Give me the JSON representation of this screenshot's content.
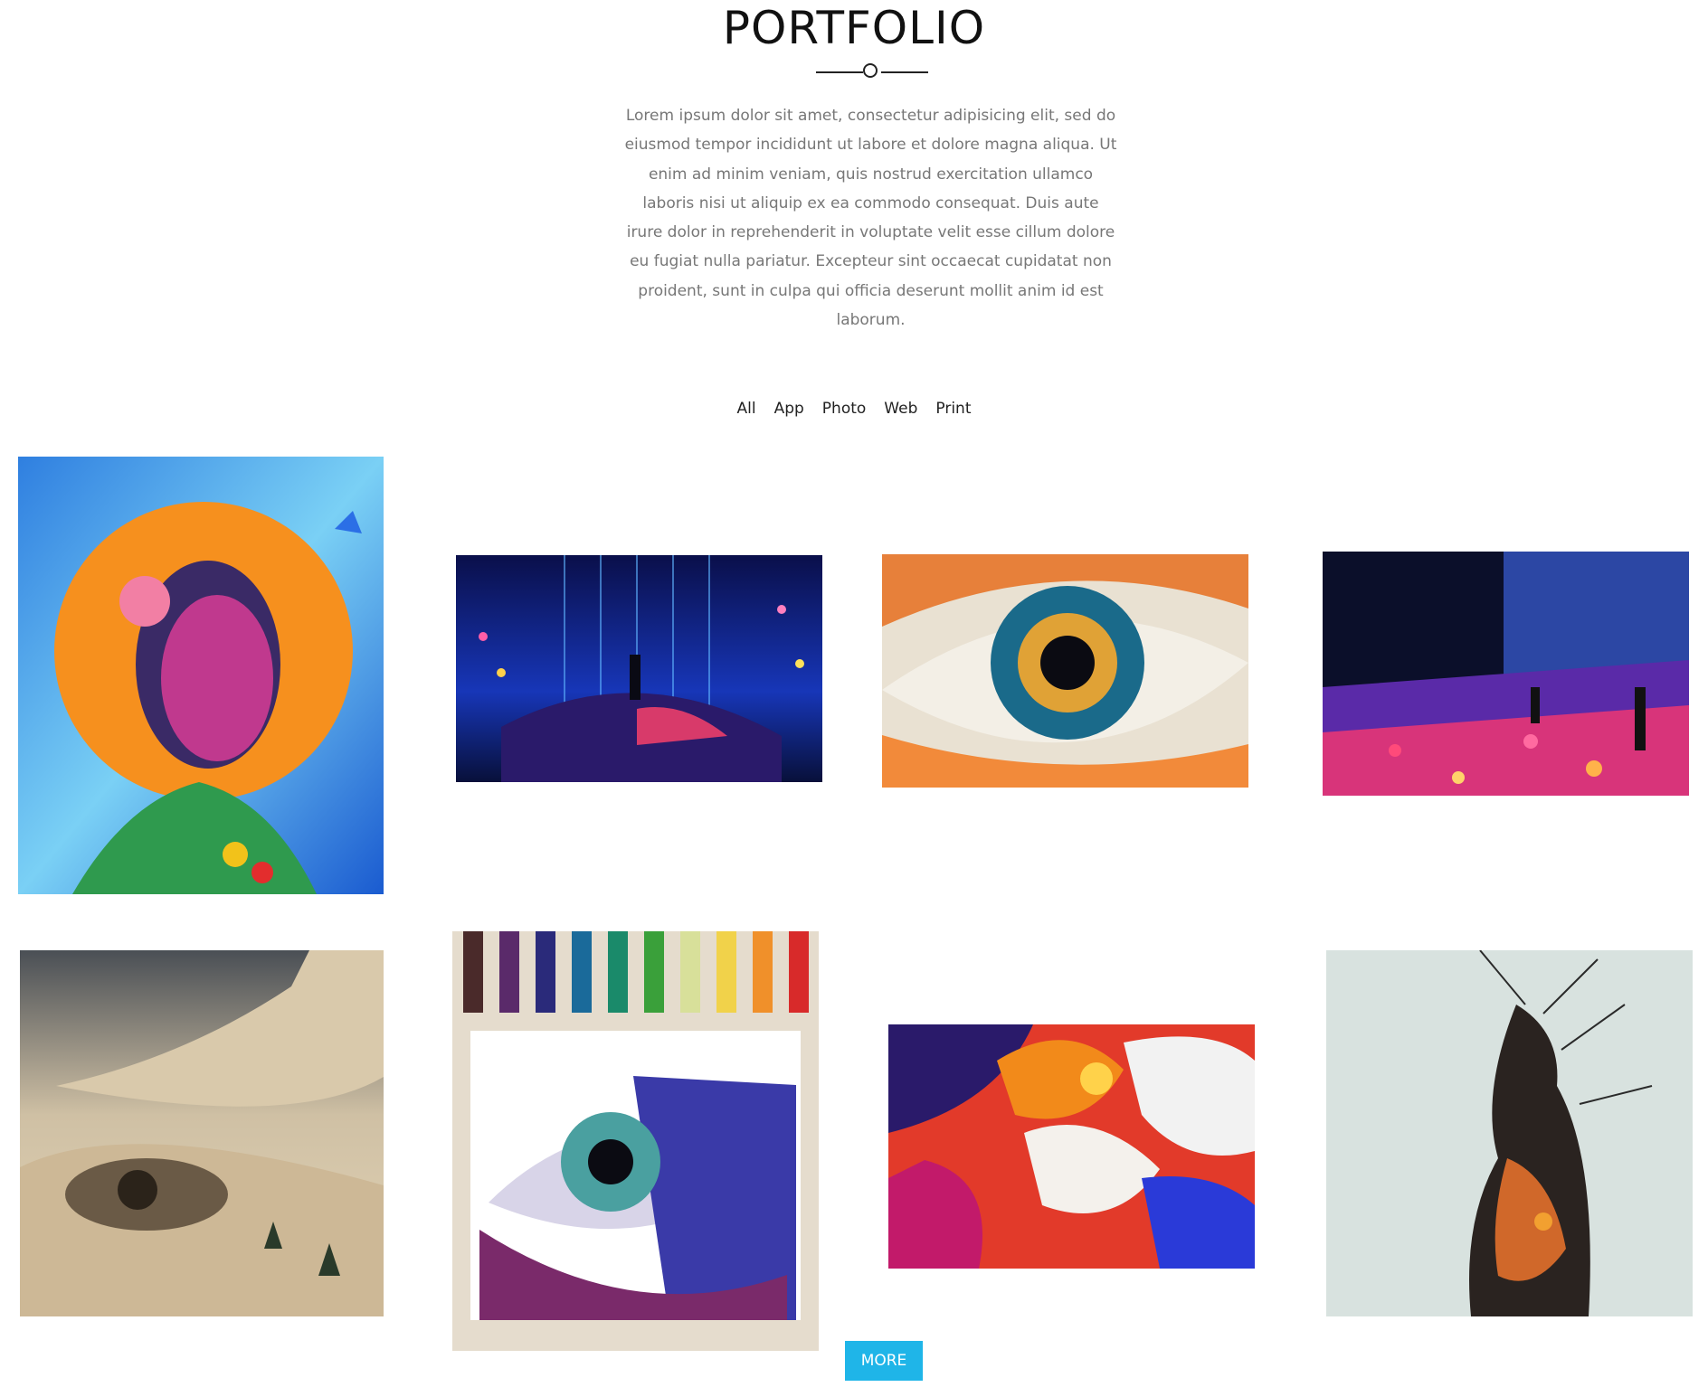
{
  "section": {
    "title": "PORTFOLIO",
    "intro": "Lorem ipsum dolor sit amet, consectetur adipisicing elit, sed do eiusmod tempor incididunt ut labore et dolore magna aliqua. Ut enim ad minim veniam, quis nostrud exercitation ullamco laboris nisi ut aliquip ex ea commodo consequat. Duis aute irure dolor in reprehenderit in voluptate velit esse cillum dolore eu fugiat nulla pariatur. Excepteur sint occaecat cupidatat non proident, sunt in culpa qui officia deserunt mollit anim id est laborum."
  },
  "filters": [
    "All",
    "App",
    "Photo",
    "Web",
    "Print"
  ],
  "more_label": "MORE",
  "colors": {
    "accent": "#1fb5e8",
    "text": "#111111",
    "muted": "#777777"
  }
}
